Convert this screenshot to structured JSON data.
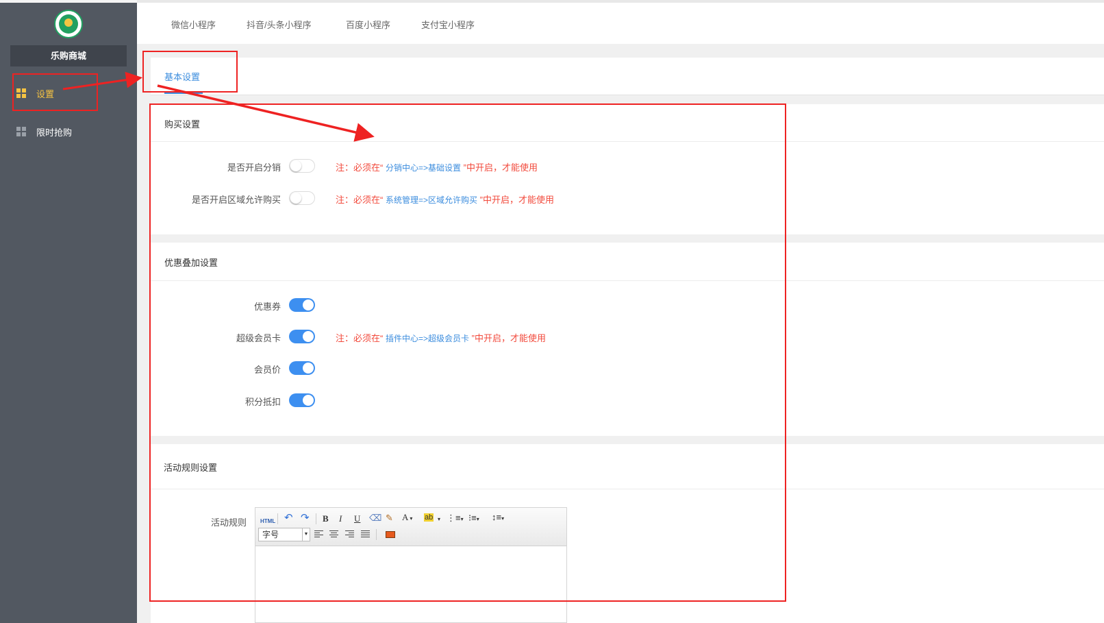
{
  "sidebar": {
    "shop_name": "乐购商城",
    "items": [
      {
        "label": "设置",
        "icon": "grid-icon",
        "active": true
      },
      {
        "label": "限时抢购",
        "icon": "grid-icon",
        "active": false
      }
    ]
  },
  "top_tabs": [
    "微信小程序",
    "抖音/头条小程序",
    "百度小程序",
    "支付宝小程序"
  ],
  "content_tab": "基本设置",
  "purchase": {
    "title": "购买设置",
    "rows": [
      {
        "label": "是否开启分销",
        "on": false,
        "note_pre": "注：必须在“",
        "note_link": "分销中心=>基础设置",
        "note_post": "”中开启，才能使用"
      },
      {
        "label": "是否开启区域允许购买",
        "on": false,
        "note_pre": "注：必须在“",
        "note_link": "系统管理=>区域允许购买",
        "note_post": "”中开启，才能使用"
      }
    ]
  },
  "discount": {
    "title": "优惠叠加设置",
    "rows": [
      {
        "label": "优惠券",
        "on": true
      },
      {
        "label": "超级会员卡",
        "on": true,
        "note_pre": "注：必须在“",
        "note_link": "插件中心=>超级会员卡",
        "note_post": "”中开启，才能使用"
      },
      {
        "label": "会员价",
        "on": true
      },
      {
        "label": "积分抵扣",
        "on": true
      }
    ]
  },
  "rules": {
    "title": "活动规则设置",
    "field_label": "活动规则",
    "toolbar": {
      "html": "HTML",
      "undo": "↶",
      "redo": "↷",
      "bold": "B",
      "italic": "I",
      "underline": "U",
      "font_color": "A",
      "highlight": "ab",
      "font_size": "字号"
    }
  },
  "colors": {
    "sidebar_bg": "#525861",
    "accent_blue": "#3c8dde",
    "active_yellow": "#f5c342",
    "note_red": "#f24a3c",
    "annotation_red": "#ee2222"
  }
}
